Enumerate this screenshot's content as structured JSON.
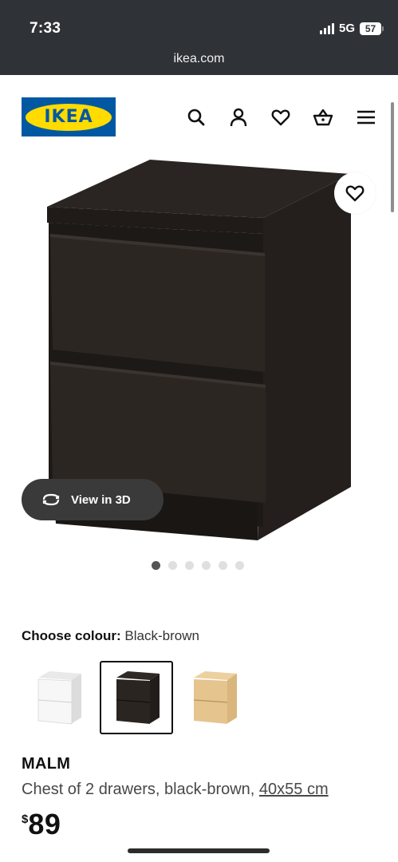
{
  "status_bar": {
    "time": "7:33",
    "network": "5G",
    "battery": "57"
  },
  "browser": {
    "url": "ikea.com"
  },
  "header": {
    "logo_text": "IKEA",
    "icons": [
      "search-icon",
      "user-icon",
      "heart-icon",
      "basket-icon",
      "menu-icon"
    ]
  },
  "product_image": {
    "view_3d_label": "View in 3D",
    "carousel": {
      "total": 6,
      "active": 1
    }
  },
  "colour": {
    "label": "Choose colour:",
    "selected": "Black-brown",
    "options": [
      {
        "name": "white",
        "color": "#f4f4f4"
      },
      {
        "name": "black-brown",
        "color": "#2b2522"
      },
      {
        "name": "oak veneer",
        "color": "#e6c48d"
      }
    ]
  },
  "product": {
    "name": "MALM",
    "description": "Chest of 2 drawers, black-brown,",
    "size": "40x55 cm",
    "currency": "$",
    "price": "89"
  },
  "colors": {
    "brand_blue": "#0058a3",
    "brand_yellow": "#ffdb00",
    "furniture_dark": "#2b2522"
  }
}
